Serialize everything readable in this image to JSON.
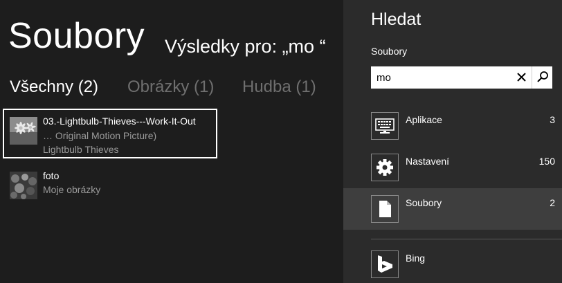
{
  "results": {
    "app_title": "Soubory",
    "results_for": "Výsledky pro: „mo “",
    "filters": [
      {
        "label": "Všechny (2)",
        "active": true
      },
      {
        "label": "Obrázky (1)",
        "active": false
      },
      {
        "label": "Hudba (1)",
        "active": false
      }
    ],
    "items": [
      {
        "title": "03.-Lightbulb-Thieves---Work-It-Out",
        "line2": "… Original Motion Picture)",
        "line3": "Lightbulb Thieves",
        "thumb": "daisy-photo-icon"
      },
      {
        "title": "foto",
        "line2": "Moje obrázky",
        "thumb": "dark-flowers-photo-icon"
      }
    ]
  },
  "pane": {
    "title": "Hledat",
    "scope_label": "Soubory",
    "search": {
      "value": "mo",
      "placeholder": ""
    },
    "scopes": [
      {
        "label": "Aplikace",
        "count": "3",
        "icon": "keyboard-monitor-icon"
      },
      {
        "label": "Nastavení",
        "count": "150",
        "icon": "gear-icon"
      },
      {
        "label": "Soubory",
        "count": "2",
        "icon": "document-icon",
        "active": true
      },
      {
        "label": "Bing",
        "count": "",
        "icon": "bing-icon"
      }
    ]
  },
  "colors": {
    "results_bg": "#1d1d1d",
    "pane_bg": "#2b2b2b",
    "active_row_bg": "#3e3e3e",
    "inactive_filter": "#6f6f6f",
    "secondary_text": "#9a9a9a"
  }
}
